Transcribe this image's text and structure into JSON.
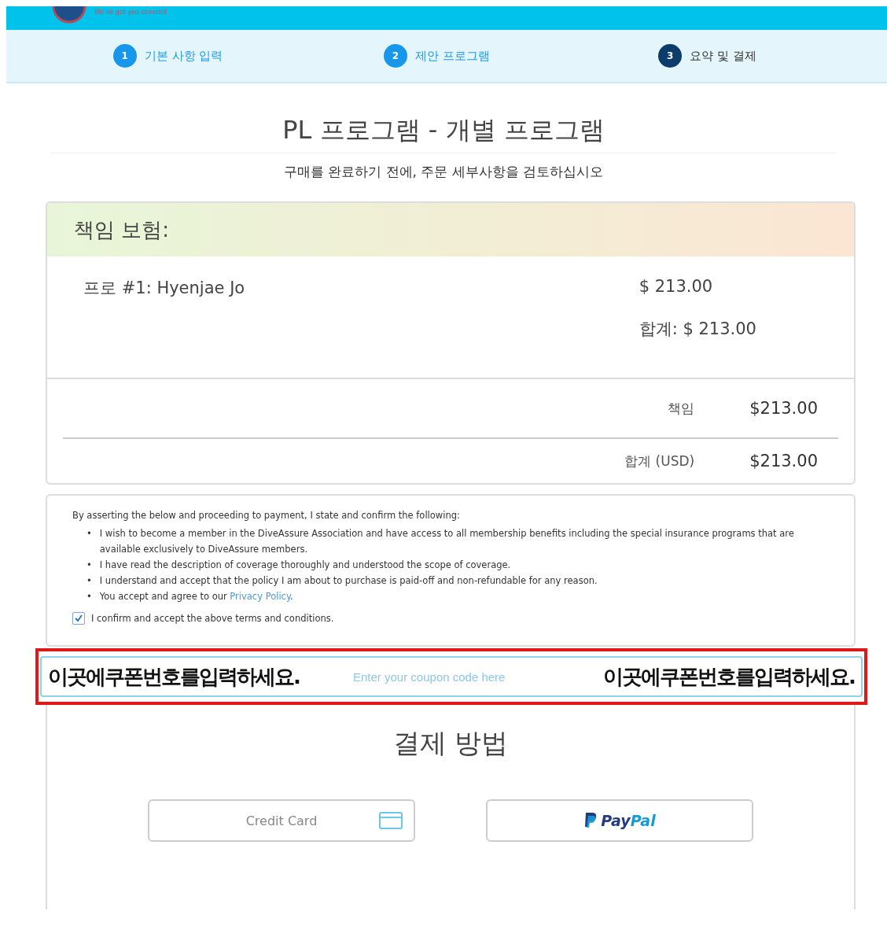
{
  "header": {
    "tagline": "We've got you covered"
  },
  "steps": [
    {
      "number": "1",
      "label": "기본 사항 입력",
      "selected": false
    },
    {
      "number": "2",
      "label": "제안 프로그램",
      "selected": false
    },
    {
      "number": "3",
      "label": "요약 및 결제",
      "selected": true
    }
  ],
  "page_title": "PL 프로그램 - 개별 프로그램",
  "subtitle": "구매를 완료하기 전에, 주문 세부사항을 검토하십시오",
  "order": {
    "heading": "책임 보험:",
    "item_label": "프로 #1: Hyenjae Jo",
    "item_price": "$ 213.00",
    "item_total": "합계: $ 213.00",
    "summary": [
      {
        "label": "책임",
        "value": "$213.00"
      },
      {
        "label": "합계 (USD)",
        "value": "$213.00"
      }
    ]
  },
  "terms": {
    "marker": "•",
    "intro": "By asserting the below and proceeding to payment, I state and confirm the following:",
    "items": [
      {
        "text": "I wish to become a member in the DiveAssure Association and have access to all membership benefits including the special insurance programs that are available exclusively to DiveAssure members."
      },
      {
        "text": "I have read the description of coverage thoroughly and understood the scope of coverage."
      },
      {
        "text": "I understand and accept that the policy I am about to purchase is paid-off and non-refundable for any reason."
      },
      {
        "text": "You accept and agree to our",
        "link": "Privacy Policy",
        "after": "."
      }
    ],
    "confirm": {
      "label": "I confirm and accept the above terms and conditions.",
      "checked": true
    }
  },
  "coupon": {
    "highlighted": true,
    "note_left": "이곳에쿠폰번호를입력하세요.",
    "placeholder": "Enter your coupon code here",
    "note_right": "이곳에쿠폰번호를입력하세요."
  },
  "payment": {
    "title": "결제 방법",
    "credit_card": "Credit Card",
    "paypal": [
      "Pay",
      "Pal"
    ]
  }
}
